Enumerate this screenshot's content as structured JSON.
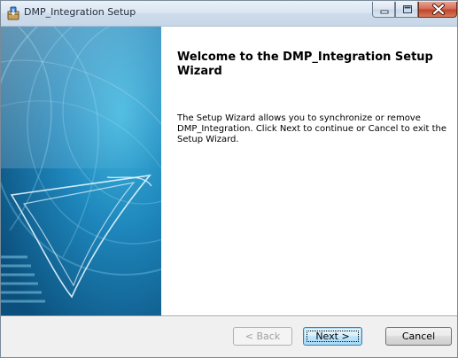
{
  "window": {
    "title": "DMP_Integration Setup"
  },
  "content": {
    "heading": "Welcome to the DMP_Integration Setup Wizard",
    "body": "The Setup Wizard allows you to synchronize or remove DMP_Integration. Click Next to continue or Cancel to exit the Setup Wizard."
  },
  "buttons": {
    "back": {
      "label": "< Back",
      "enabled": false
    },
    "next": {
      "label": "Next >",
      "enabled": true,
      "default": true
    },
    "cancel": {
      "label": "Cancel",
      "enabled": true
    }
  },
  "icons": {
    "title": "installer-package-icon",
    "minimize": "minimize-icon",
    "maximize": "maximize-icon",
    "close": "close-icon",
    "banner": "wizard-banner-graphic"
  },
  "colors": {
    "banner_dark": "#0f5a86",
    "banner_light": "#2aa1cf",
    "close_red": "#c2452a",
    "default_button_border": "#3c7fb1"
  }
}
